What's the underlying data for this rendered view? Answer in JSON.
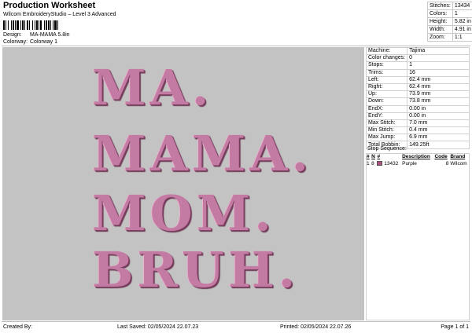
{
  "header": {
    "title": "Production Worksheet",
    "subtitle": "Wilcom EmbroideryStudio – Level 3 Advanced",
    "design_label": "Design:",
    "design_value": "MA-MAMA 5.8in",
    "colorway_label": "Colorway:",
    "colorway_value": "Colorway 1"
  },
  "summary": [
    {
      "label": "Stitches:",
      "value": "13434"
    },
    {
      "label": "Colors:",
      "value": "1"
    },
    {
      "label": "Height:",
      "value": "5.82 in"
    },
    {
      "label": "Width:",
      "value": "4.91 in"
    },
    {
      "label": "Zoom:",
      "value": "1:1"
    }
  ],
  "design_text": [
    "MA.",
    "MAMA.",
    "MOM.",
    "BRUH."
  ],
  "thread_color": "#c47ba3",
  "specs": [
    {
      "label": "Machine:",
      "value": "Tajima"
    },
    {
      "label": "Color changes:",
      "value": "0"
    },
    {
      "label": "Stops:",
      "value": "1"
    },
    {
      "label": "Trims:",
      "value": "16"
    },
    {
      "label": "Left:",
      "value": "62.4 mm"
    },
    {
      "label": "Right:",
      "value": "62.4 mm"
    },
    {
      "label": "Up:",
      "value": "73.9 mm"
    },
    {
      "label": "Down:",
      "value": "73.8 mm"
    },
    {
      "label": "EndX:",
      "value": "0.00 in"
    },
    {
      "label": "EndY:",
      "value": "0.00 in"
    },
    {
      "label": "Max Stitch:",
      "value": "7.0 mm"
    },
    {
      "label": "Min Stitch:",
      "value": "0.4 mm"
    },
    {
      "label": "Max Jump:",
      "value": "6.9 mm"
    },
    {
      "label": "Total Bobbin:",
      "value": "149.25ft"
    }
  ],
  "stop_sequence": {
    "title": "Stop Sequence:",
    "headers": [
      "#",
      "N",
      "#",
      "Description",
      "Code",
      "Brand"
    ],
    "rows": [
      {
        "num": "1",
        "needle": "8",
        "stitches": "13432",
        "description": "Purple",
        "code": "8",
        "brand": "Wilcom",
        "color": "#b0507f"
      }
    ]
  },
  "footer": {
    "created_by": "Created By:",
    "last_saved": "Last Saved: 02/05/2024 22.07.23",
    "printed": "Printed: 02/05/2024 22.07.26",
    "page": "Page 1 of 1"
  }
}
